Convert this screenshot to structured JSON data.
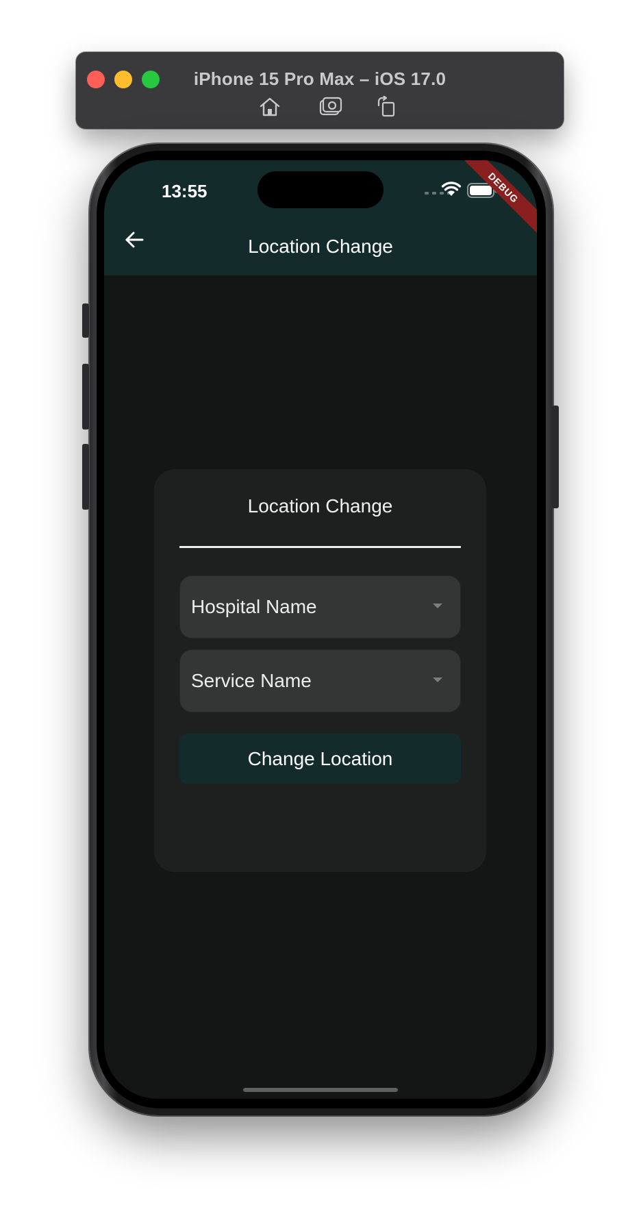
{
  "simulator": {
    "title": "iPhone 15 Pro Max – iOS 17.0",
    "buttons": [
      "home-icon",
      "screenshot-icon",
      "rotate-icon"
    ]
  },
  "status_bar": {
    "time": "13:55",
    "debug_label": "DEBUG"
  },
  "app_bar": {
    "title": "Location Change",
    "back_icon": "arrow-back-icon",
    "background": "#142b2c"
  },
  "card": {
    "title": "Location Change",
    "hospital_dropdown": {
      "placeholder": "Hospital Name"
    },
    "service_dropdown": {
      "placeholder": "Service Name"
    },
    "button_label": "Change Location"
  },
  "colors": {
    "screen_background": "#141515",
    "card_background": "#1e1f1f",
    "dropdown_background": "#343535",
    "debug_ribbon": "#8a1f1f"
  }
}
